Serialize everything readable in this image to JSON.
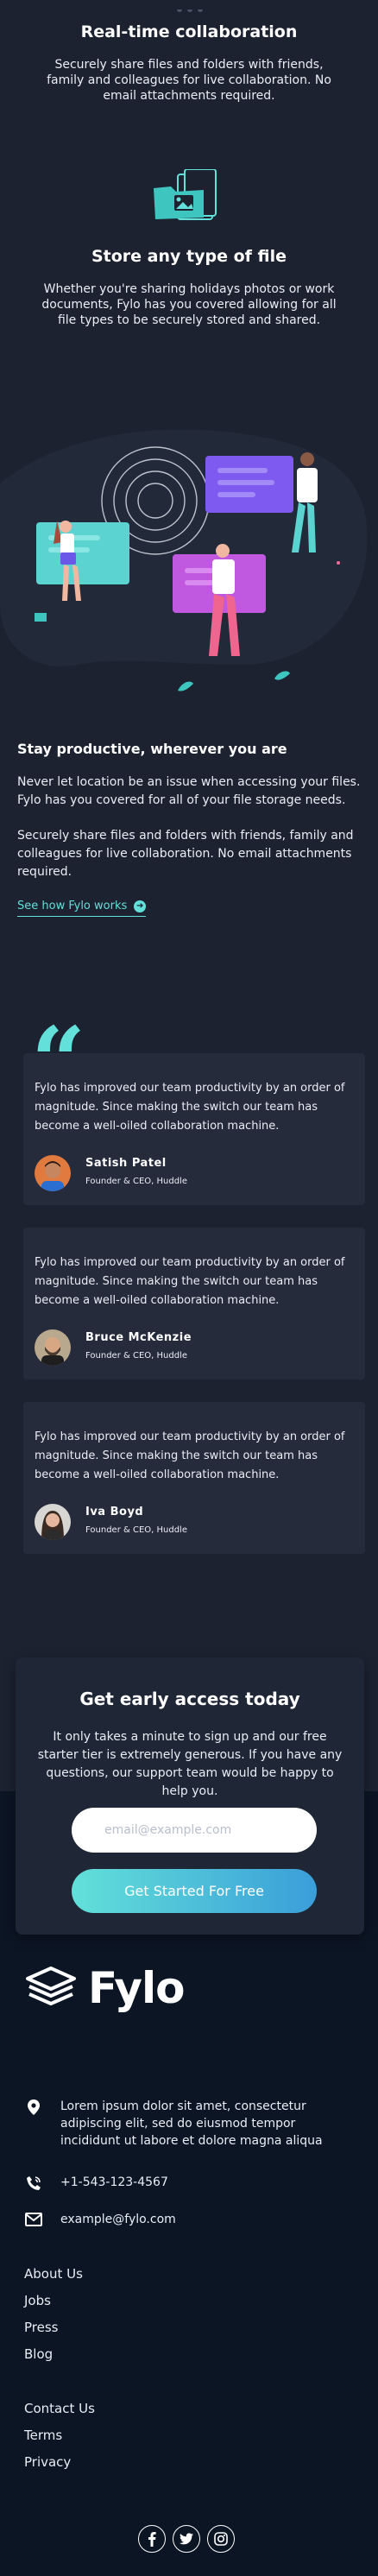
{
  "collab": {
    "title": "Real-time collaboration",
    "text": "Securely share files and folders with friends, family and colleagues for live collaboration. No email attachments required."
  },
  "store": {
    "title": "Store any type of file",
    "text": "Whether you're sharing holidays photos or work documents, Fylo has you covered allowing for all file types to be securely stored and shared."
  },
  "productive": {
    "title": "Stay productive, wherever you are",
    "para1": "Never let location be an issue when accessing your files. Fylo has you covered for all of your file storage needs.",
    "para2": "Securely share files and folders with friends, family and colleagues for live collaboration. No email attachments required.",
    "link": "See how Fylo works",
    "link_icon": "arrow-right-icon"
  },
  "testimonials": [
    {
      "quote": "Fylo has improved our team productivity by an order of magnitude. Since making the switch our team has become a well-oiled collaboration machine.",
      "name": "Satish Patel",
      "role": "Founder & CEO, Huddle"
    },
    {
      "quote": "Fylo has improved our team productivity by an order of magnitude. Since making the switch our team has become a well-oiled collaboration machine.",
      "name": "Bruce McKenzie",
      "role": "Founder & CEO, Huddle"
    },
    {
      "quote": "Fylo has improved our team productivity by an order of magnitude. Since making the switch our team has become a well-oiled collaboration machine.",
      "name": "Iva Boyd",
      "role": "Founder & CEO, Huddle"
    }
  ],
  "cta": {
    "title": "Get early access today",
    "text": "It only takes a minute to sign up and our free starter tier is extremely generous. If you have any questions, our support team would be happy to help you.",
    "email_placeholder": "email@example.com",
    "button": "Get Started For Free"
  },
  "footer": {
    "brand": "Fylo",
    "address": "Lorem ipsum dolor sit amet, consectetur adipiscing elit, sed do eiusmod tempor incididunt ut labore et dolore magna aliqua",
    "phone": "+1-543-123-4567",
    "email": "example@fylo.com",
    "links_primary": [
      "About Us",
      "Jobs",
      "Press",
      "Blog"
    ],
    "links_secondary": [
      "Contact Us",
      "Terms",
      "Privacy"
    ],
    "socials": [
      "facebook-icon",
      "twitter-icon",
      "instagram-icon"
    ]
  },
  "colors": {
    "background": "#1c2230",
    "card": "#252b3b",
    "footer": "#0c1524",
    "accent": "#62e0d9",
    "accent_blue": "#3a9ed9"
  }
}
